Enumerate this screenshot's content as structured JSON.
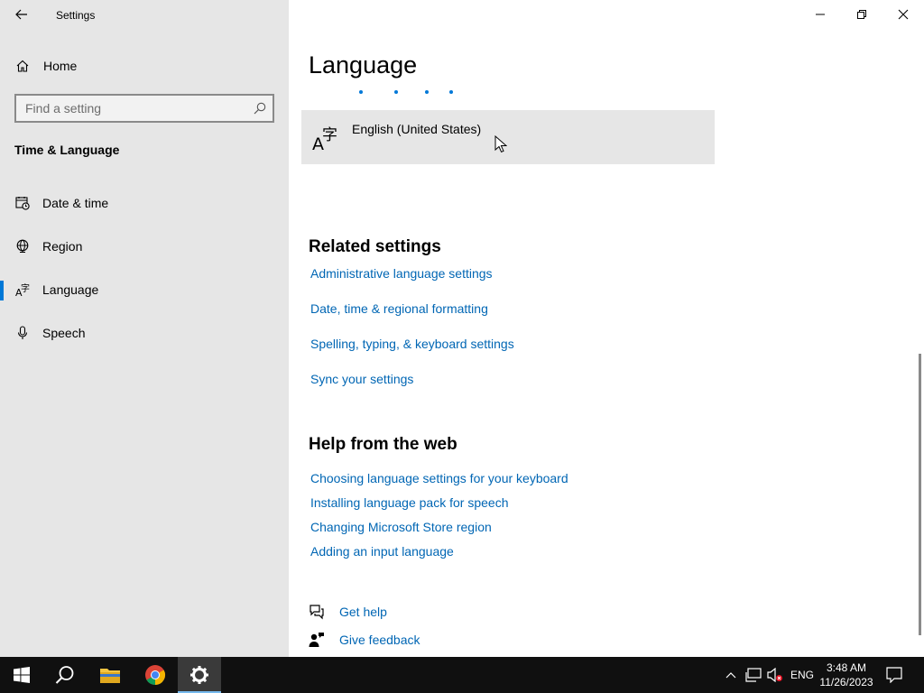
{
  "window": {
    "title": "Settings"
  },
  "sidebar": {
    "home_label": "Home",
    "search_placeholder": "Find a setting",
    "section_title": "Time & Language",
    "items": [
      {
        "label": "Date & time",
        "icon": "calendar-clock-icon",
        "active": false
      },
      {
        "label": "Region",
        "icon": "globe-icon",
        "active": false
      },
      {
        "label": "Language",
        "icon": "language-icon",
        "active": true
      },
      {
        "label": "Speech",
        "icon": "microphone-icon",
        "active": false
      }
    ]
  },
  "main": {
    "page_title": "Language",
    "language_item": "English (United States)",
    "related_heading": "Related settings",
    "related_links": [
      "Administrative language settings",
      "Date, time & regional formatting",
      "Spelling, typing, & keyboard settings",
      "Sync your settings"
    ],
    "help_heading": "Help from the web",
    "help_links": [
      "Choosing language settings for your keyboard",
      "Installing language pack for speech",
      "Changing Microsoft Store region",
      "Adding an input language"
    ],
    "get_help": "Get help",
    "give_feedback": "Give feedback"
  },
  "taskbar": {
    "input_language": "ENG",
    "time": "3:48 AM",
    "date": "11/26/2023"
  },
  "colors": {
    "accent": "#0078d7",
    "link": "#0066b4",
    "sidebar_bg": "#e6e6e6",
    "taskbar_bg": "#101010"
  }
}
